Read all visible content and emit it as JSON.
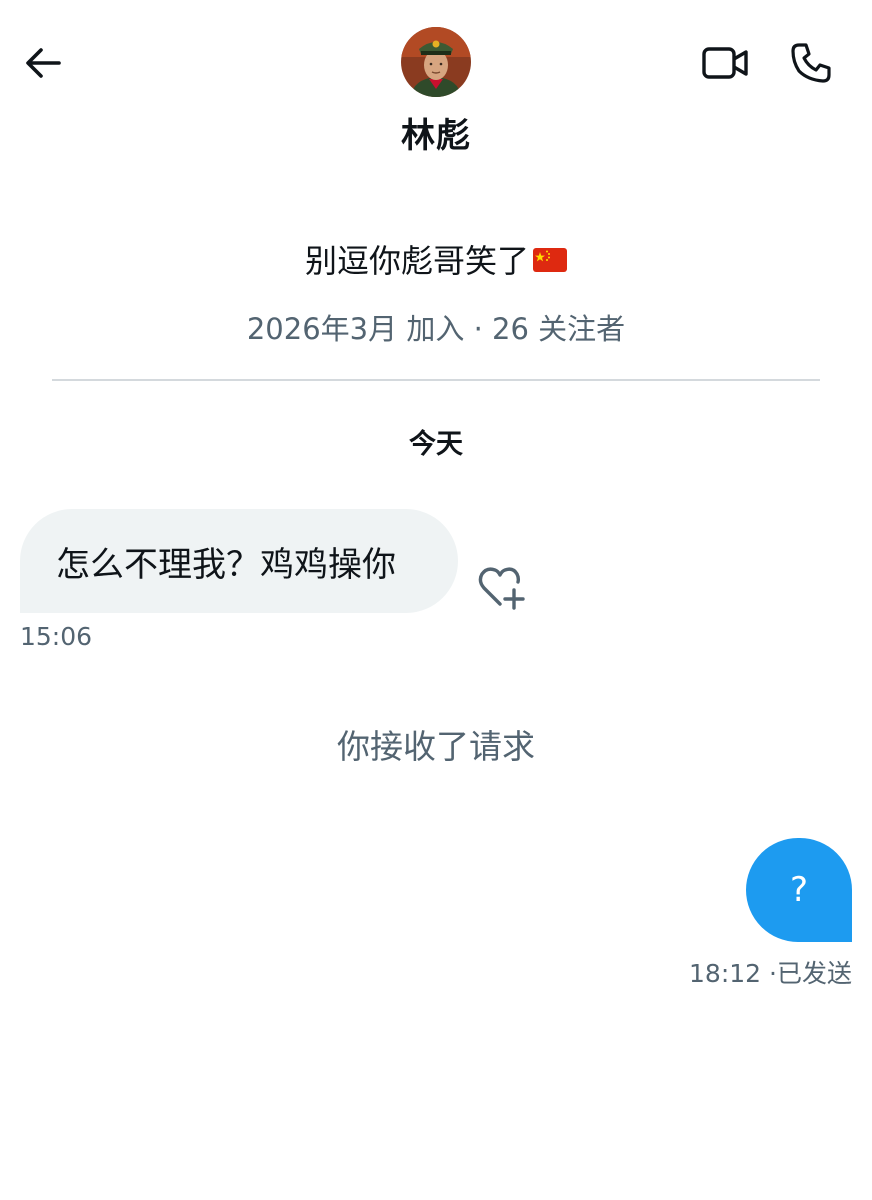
{
  "header": {
    "contact_name": "林彪",
    "back_icon": "arrow-left-icon",
    "video_icon": "video-camera-icon",
    "call_icon": "phone-icon"
  },
  "profile": {
    "bio": "别逗你彪哥笑了",
    "bio_emoji": "china-flag-icon",
    "joined": "2026年3月 加入",
    "separator": "·",
    "followers": "26 关注者"
  },
  "conversation": {
    "day_label": "今天",
    "messages": [
      {
        "direction": "incoming",
        "text": "怎么不理我？鸡鸡操你",
        "time": "15:06"
      },
      {
        "direction": "system",
        "text": "你接收了请求"
      },
      {
        "direction": "outgoing",
        "text": "?",
        "time": "18:12",
        "status": "已发送"
      }
    ],
    "reaction_icon": "heart-plus-icon"
  },
  "colors": {
    "accent": "#1d9bf0",
    "incoming_bubble": "#eff3f4",
    "secondary_text": "#536471",
    "primary_text": "#0f1419"
  }
}
